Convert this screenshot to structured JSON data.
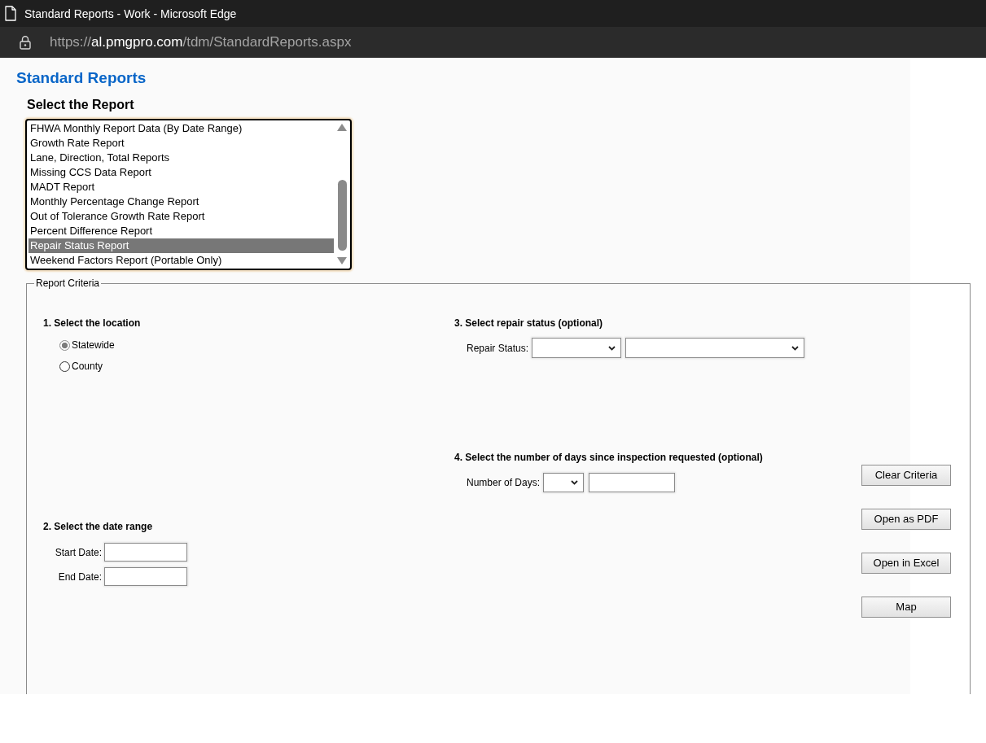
{
  "window": {
    "title": "Standard Reports - Work - Microsoft Edge"
  },
  "address_bar": {
    "scheme": "https://",
    "host": "al.pmgpro.com",
    "path": "/tdm/StandardReports.aspx"
  },
  "heading": "Standard Reports",
  "report_select": {
    "label": "Select the Report",
    "items": [
      {
        "label": "FHWA Monthly Report Data (By Date Range)",
        "selected": false
      },
      {
        "label": "Growth Rate Report",
        "selected": false
      },
      {
        "label": "Lane, Direction, Total Reports",
        "selected": false
      },
      {
        "label": "Missing CCS Data Report",
        "selected": false
      },
      {
        "label": "MADT Report",
        "selected": false
      },
      {
        "label": "Monthly Percentage Change Report",
        "selected": false
      },
      {
        "label": "Out of Tolerance Growth Rate Report",
        "selected": false
      },
      {
        "label": "Percent Difference Report",
        "selected": false
      },
      {
        "label": "Repair Status Report",
        "selected": true
      },
      {
        "label": "Weekend Factors Report (Portable Only)",
        "selected": false
      }
    ]
  },
  "criteria": {
    "legend": "Report Criteria",
    "location": {
      "heading": "1. Select the location",
      "options": [
        {
          "label": "Statewide",
          "selected": true
        },
        {
          "label": "County",
          "selected": false
        }
      ]
    },
    "date_range": {
      "heading": "2. Select the date range",
      "fields": [
        {
          "label": "Start Date:"
        },
        {
          "label": "End Date:"
        }
      ]
    },
    "repair_status": {
      "heading": "3. Select repair status (optional)",
      "label": "Repair Status:"
    },
    "days": {
      "heading": "4. Select the number of days since inspection requested (optional)",
      "label": "Number of Days:"
    },
    "buttons": [
      "Clear Criteria",
      "Open as PDF",
      "Open in Excel",
      "Map"
    ]
  }
}
